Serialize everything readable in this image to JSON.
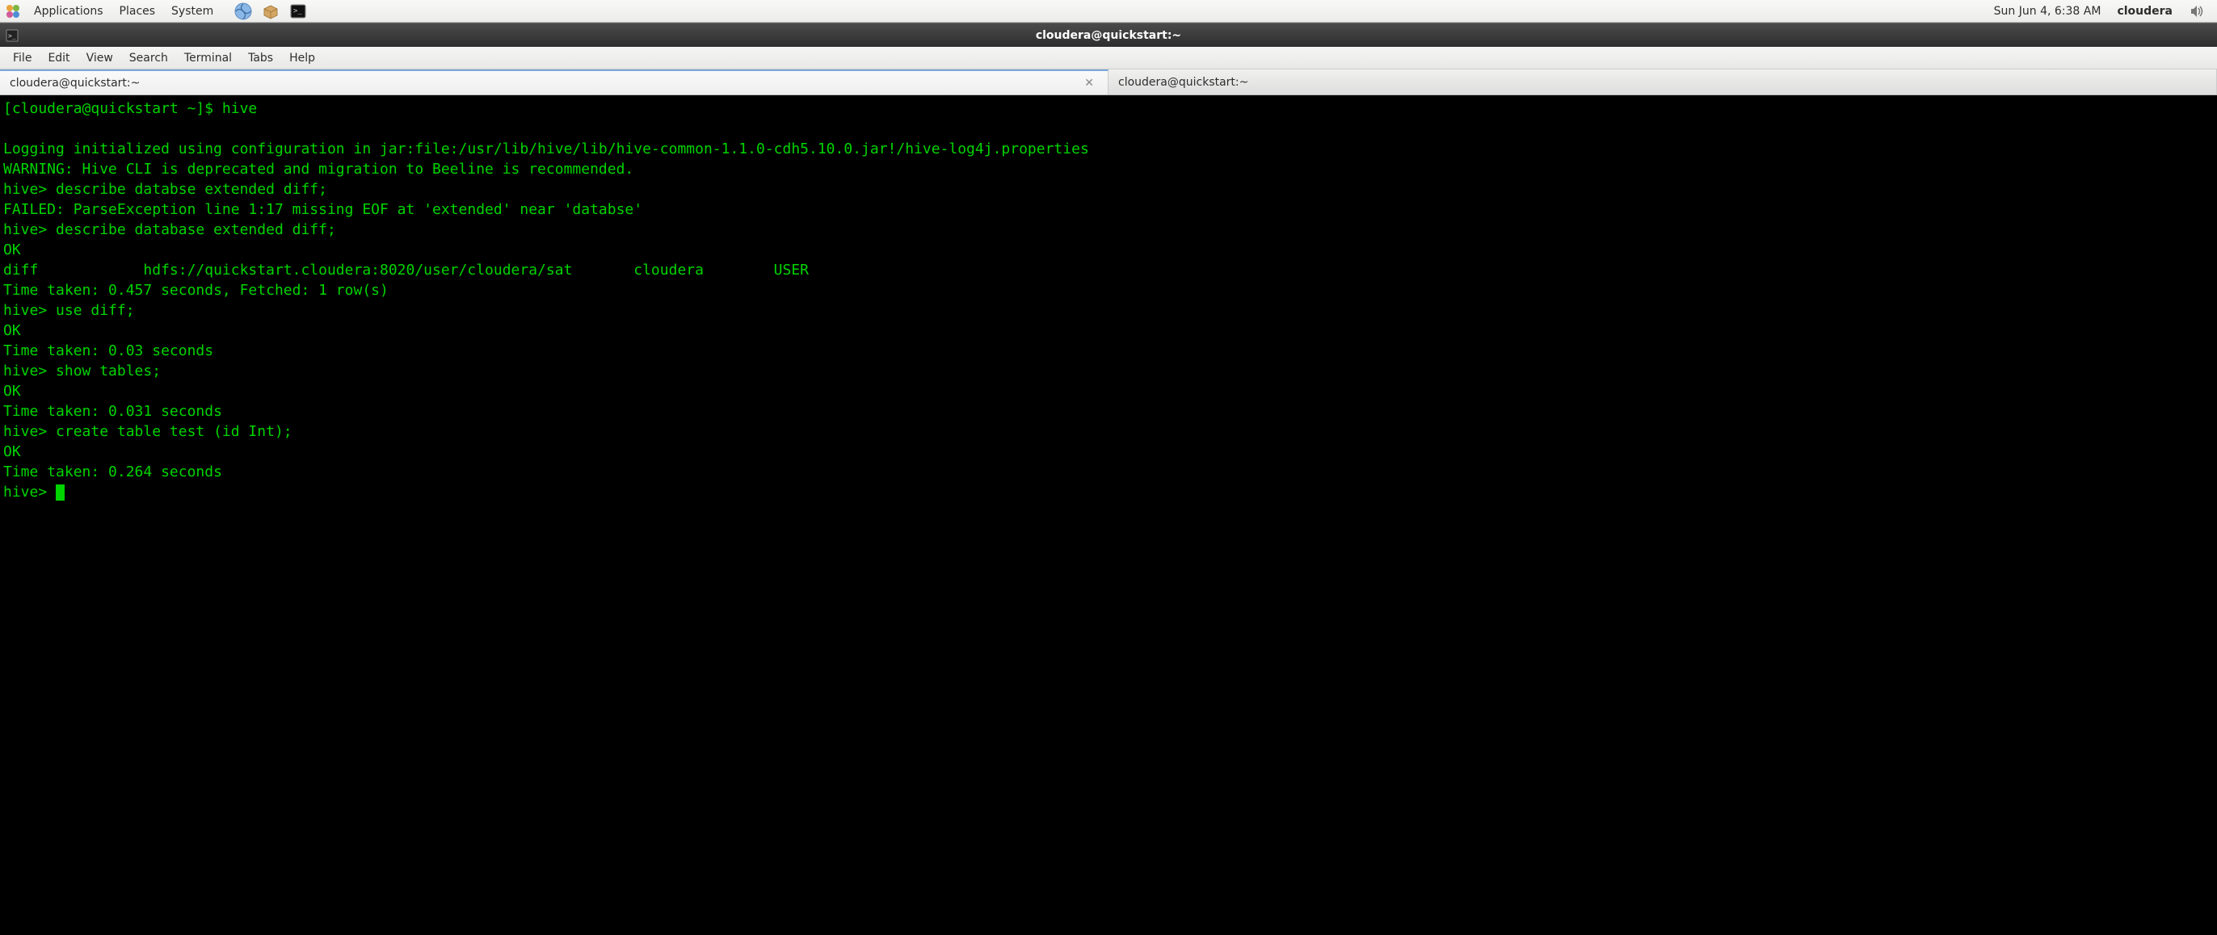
{
  "panel": {
    "menus": [
      "Applications",
      "Places",
      "System"
    ],
    "clock": "Sun Jun  4,  6:38 AM",
    "user": "cloudera"
  },
  "window": {
    "title": "cloudera@quickstart:~"
  },
  "menubar": {
    "items": [
      "File",
      "Edit",
      "View",
      "Search",
      "Terminal",
      "Tabs",
      "Help"
    ]
  },
  "tabs": [
    {
      "label": "cloudera@quickstart:~",
      "active": true,
      "closable": true
    },
    {
      "label": "cloudera@quickstart:~",
      "active": false,
      "closable": false
    }
  ],
  "terminal": {
    "lines": [
      "[cloudera@quickstart ~]$ hive",
      "",
      "Logging initialized using configuration in jar:file:/usr/lib/hive/lib/hive-common-1.1.0-cdh5.10.0.jar!/hive-log4j.properties",
      "WARNING: Hive CLI is deprecated and migration to Beeline is recommended.",
      "hive> describe databse extended diff;",
      "FAILED: ParseException line 1:17 missing EOF at 'extended' near 'databse'",
      "hive> describe database extended diff;",
      "OK",
      "diff            hdfs://quickstart.cloudera:8020/user/cloudera/sat       cloudera        USER",
      "Time taken: 0.457 seconds, Fetched: 1 row(s)",
      "hive> use diff;",
      "OK",
      "Time taken: 0.03 seconds",
      "hive> show tables;",
      "OK",
      "Time taken: 0.031 seconds",
      "hive> create table test (id Int);",
      "OK",
      "Time taken: 0.264 seconds"
    ],
    "prompt": "hive> "
  }
}
